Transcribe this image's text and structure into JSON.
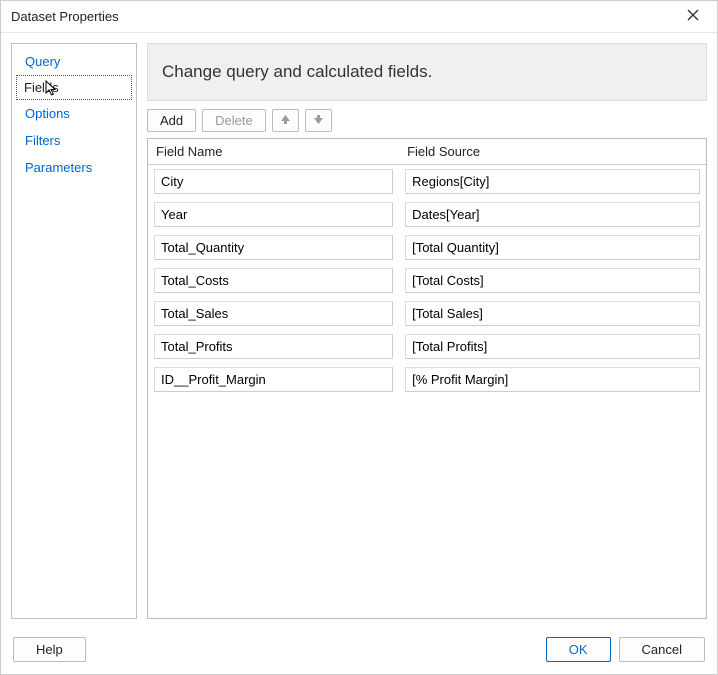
{
  "titlebar": {
    "title": "Dataset Properties"
  },
  "sidebar": {
    "items": [
      {
        "label": "Query"
      },
      {
        "label": "Fields",
        "selected": true
      },
      {
        "label": "Options"
      },
      {
        "label": "Filters"
      },
      {
        "label": "Parameters"
      }
    ]
  },
  "main": {
    "heading": "Change query and calculated fields.",
    "toolbar": {
      "add_label": "Add",
      "delete_label": "Delete"
    },
    "columns": {
      "name": "Field Name",
      "source": "Field Source"
    },
    "rows": [
      {
        "name": "City",
        "source": "Regions[City]"
      },
      {
        "name": "Year",
        "source": "Dates[Year]"
      },
      {
        "name": "Total_Quantity",
        "source": "[Total Quantity]"
      },
      {
        "name": "Total_Costs",
        "source": "[Total Costs]"
      },
      {
        "name": "Total_Sales",
        "source": "[Total Sales]"
      },
      {
        "name": "Total_Profits",
        "source": "[Total Profits]"
      },
      {
        "name": "ID__Profit_Margin",
        "source": "[% Profit Margin]"
      }
    ]
  },
  "footer": {
    "help_label": "Help",
    "ok_label": "OK",
    "cancel_label": "Cancel"
  }
}
